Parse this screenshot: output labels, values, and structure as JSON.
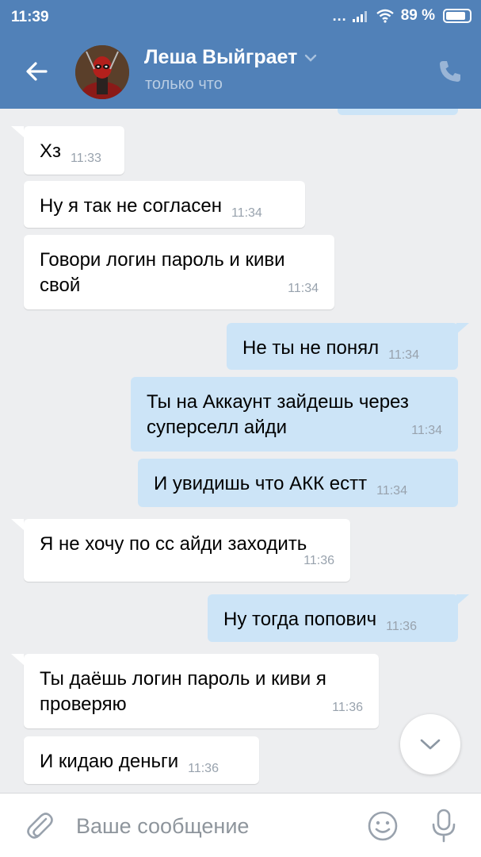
{
  "status_bar": {
    "time": "11:39",
    "signal_dots": "...",
    "battery_percent": "89 %"
  },
  "header": {
    "contact_name": "Леша Выйграет",
    "contact_status": "только что",
    "back_icon": "arrow-left-icon",
    "call_icon": "phone-icon",
    "dropdown_icon": "chevron-down-icon",
    "accent_color": "#5181b8"
  },
  "messages": [
    {
      "direction": "in",
      "text": "Хз",
      "time": "11:33"
    },
    {
      "direction": "in",
      "text": "Ну я так не согласен",
      "time": "11:34"
    },
    {
      "direction": "in",
      "text": "Говори логин пароль и киви свой",
      "time": "11:34"
    },
    {
      "direction": "out",
      "text": "Не ты не понял",
      "time": "11:34"
    },
    {
      "direction": "out",
      "text": "Ты на Аккаунт зайдешь через суперселл айди",
      "time": "11:34"
    },
    {
      "direction": "out",
      "text": "И увидишь что АКК естт",
      "time": "11:34"
    },
    {
      "direction": "in",
      "text": "Я не хочу по сс айди заходить",
      "time": "11:36"
    },
    {
      "direction": "out",
      "text": "Ну тогда попович",
      "time": "11:36"
    },
    {
      "direction": "in",
      "text": "Ты даёшь логин пароль и киви я проверяю",
      "time": "11:36"
    },
    {
      "direction": "in",
      "text": "И кидаю деньги",
      "time": "11:36"
    }
  ],
  "composer": {
    "placeholder": "Ваше сообщение",
    "value": "",
    "attach_icon": "paperclip-icon",
    "emoji_icon": "smiley-icon",
    "mic_icon": "microphone-icon"
  },
  "colors": {
    "incoming_bubble": "#ffffff",
    "outgoing_bubble": "#cce4f7",
    "background": "#edeef0"
  }
}
